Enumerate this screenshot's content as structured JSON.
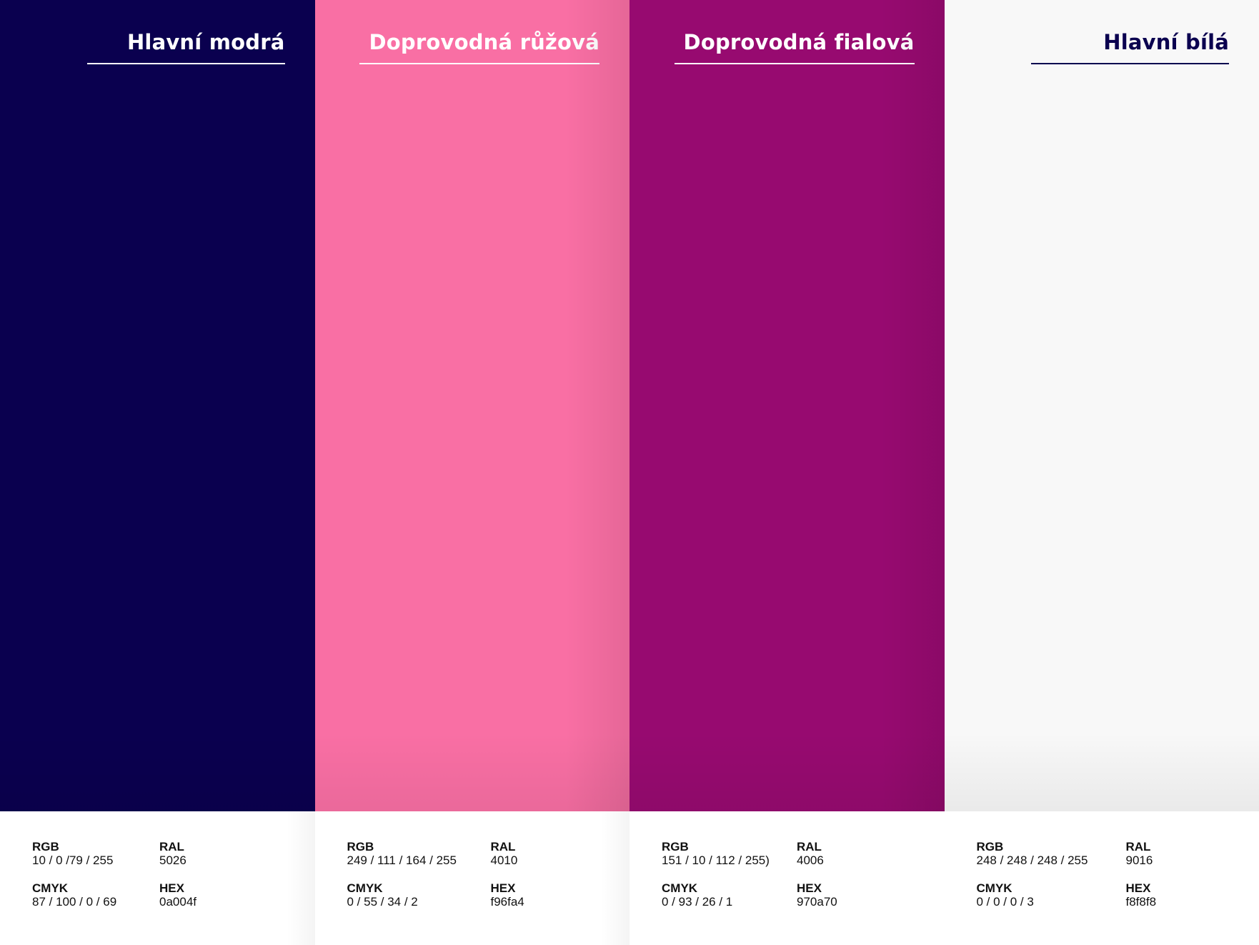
{
  "swatches": [
    {
      "title": "Hlavní modrá",
      "color": "#0a004f",
      "text_color": "#ffffff",
      "rgb_label": "RGB",
      "rgb": "10 / 0 /79 / 255",
      "ral_label": "RAL",
      "ral": "5026",
      "cmyk_label": "CMYK",
      "cmyk": "87 / 100 / 0 / 69",
      "hex_label": "HEX",
      "hex": "0a004f"
    },
    {
      "title": "Doprovodná růžová",
      "color": "#f96fa4",
      "text_color": "#ffffff",
      "rgb_label": "RGB",
      "rgb": "249 / 111 / 164 / 255",
      "ral_label": "RAL",
      "ral": "4010",
      "cmyk_label": "CMYK",
      "cmyk": "0 / 55 / 34 / 2",
      "hex_label": "HEX",
      "hex": "f96fa4"
    },
    {
      "title": "Doprovodná fialová",
      "color": "#970a70",
      "text_color": "#ffffff",
      "rgb_label": "RGB",
      "rgb": "151 / 10 / 112 / 255)",
      "ral_label": "RAL",
      "ral": "4006",
      "cmyk_label": "CMYK",
      "cmyk": "0 / 93 / 26 / 1",
      "hex_label": "HEX",
      "hex": "970a70"
    },
    {
      "title": "Hlavní bílá",
      "color": "#f8f8f8",
      "text_color": "#0a004f",
      "rgb_label": "RGB",
      "rgb": "248 / 248 / 248 / 255",
      "ral_label": "RAL",
      "ral": "9016",
      "cmyk_label": "CMYK",
      "cmyk": "0 / 0 / 0 / 3",
      "hex_label": "HEX",
      "hex": "f8f8f8"
    }
  ]
}
